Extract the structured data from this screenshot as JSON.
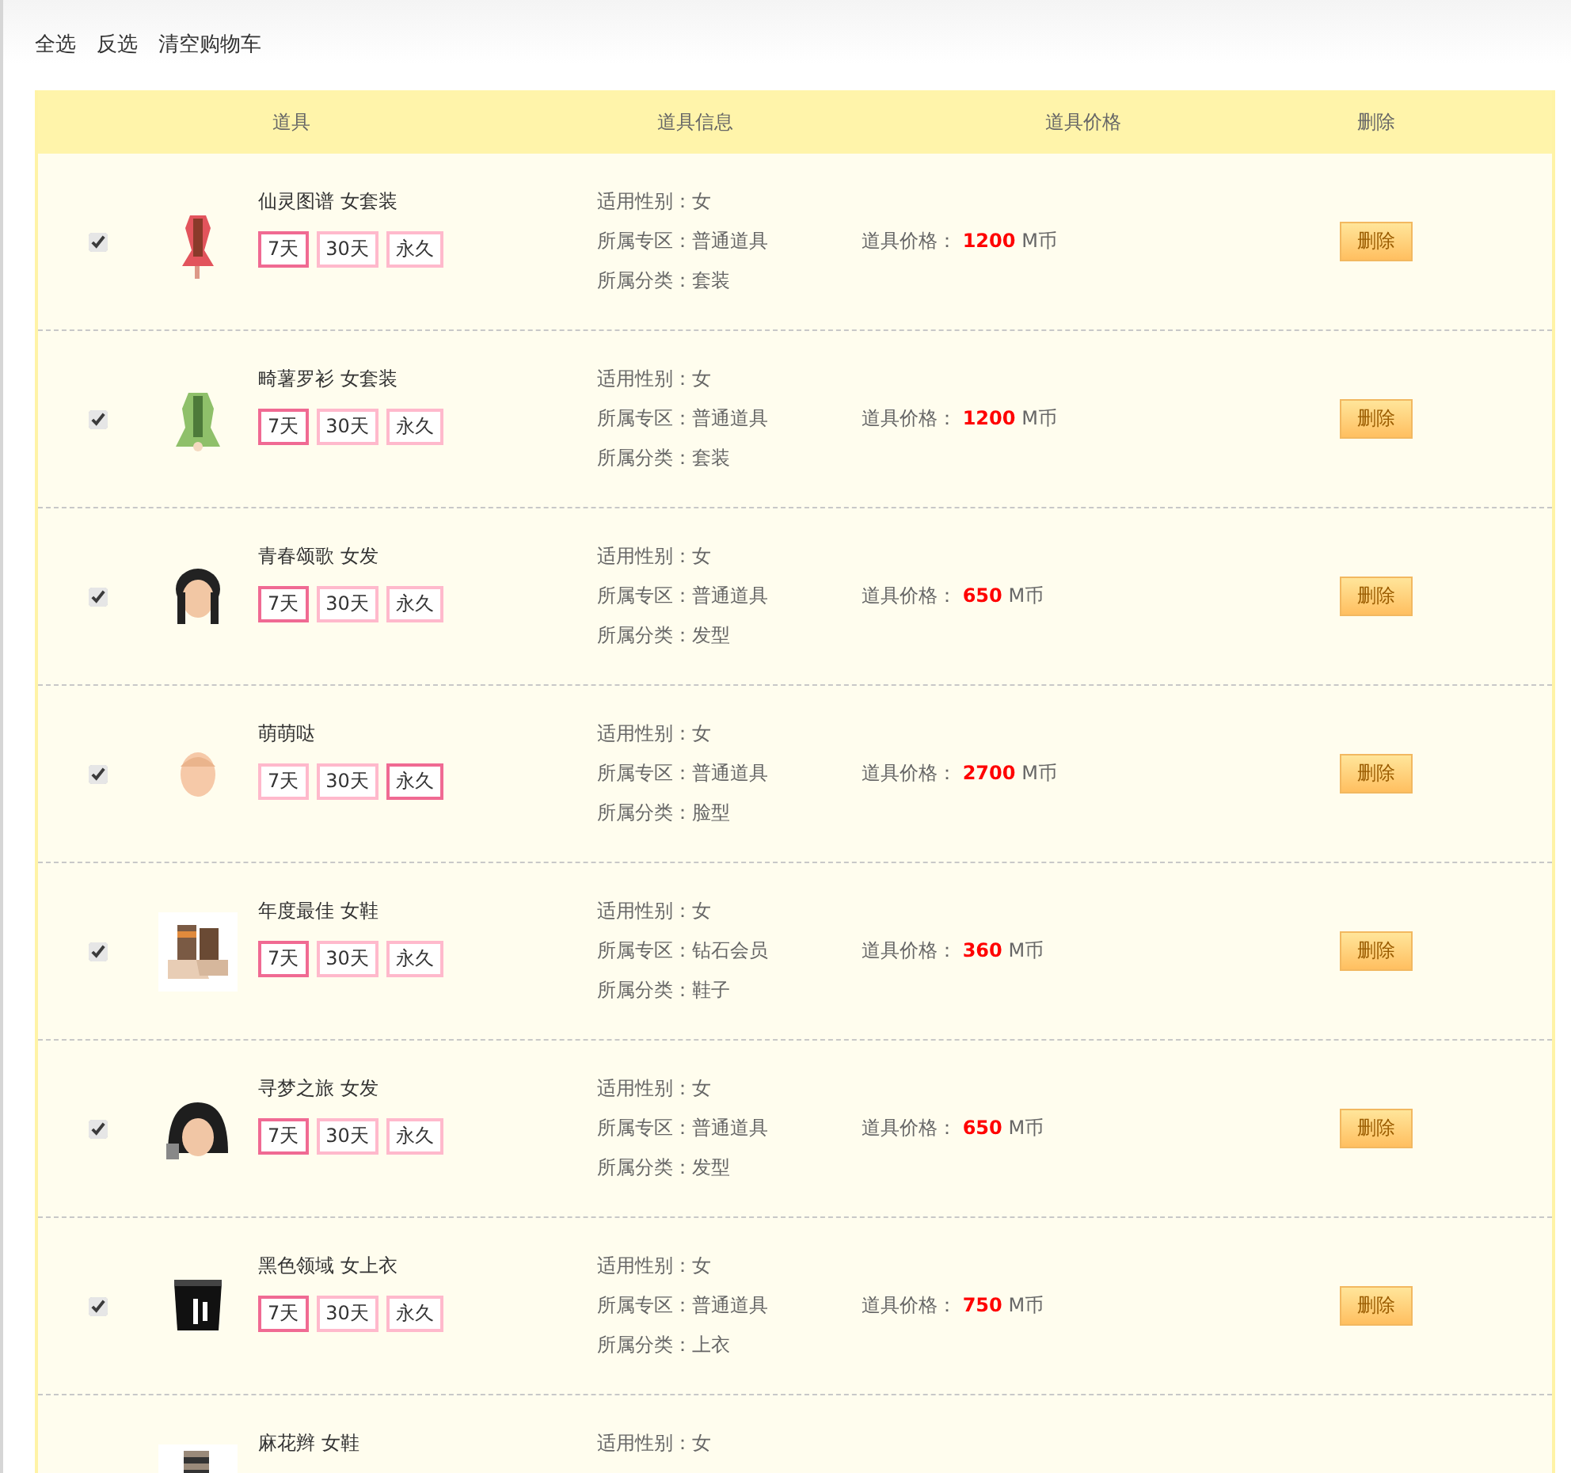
{
  "toolbar": [
    "全选",
    "反选",
    "清空购物车"
  ],
  "table": {
    "columns": [
      "道具",
      "道具信息",
      "道具价格",
      "删除"
    ],
    "rows": [
      {
        "checked": true,
        "image": {
          "kind": "picture"
        },
        "name": "仙灵图谱 女套装",
        "durations": [
          {
            "label": "7天",
            "selected": true
          },
          {
            "label": "30天",
            "selected": false
          },
          {
            "label": "永久",
            "selected": false
          }
        ],
        "info": [
          "适用性别：女",
          "所属专区：普通道具",
          "所属分类：套装"
        ],
        "price_label": "道具价格：",
        "price": "1200",
        "unit": "M币",
        "delete": "删除"
      },
      {
        "checked": true,
        "image": {
          "kind": "picture"
        },
        "name": "畸薯罗衫 女套装",
        "durations": [
          {
            "label": "7天",
            "selected": true
          },
          {
            "label": "30天",
            "selected": false
          },
          {
            "label": "永久",
            "selected": false
          }
        ],
        "info": [
          "适用性别：女",
          "所属专区：普通道具",
          "所属分类：套装"
        ],
        "price_label": "道具价格：",
        "price": "1200",
        "unit": "M币",
        "delete": "删除"
      },
      {
        "checked": true,
        "image": {
          "kind": "picture"
        },
        "name": "青春颂歌 女发",
        "durations": [
          {
            "label": "7天",
            "selected": true
          },
          {
            "label": "30天",
            "selected": false
          },
          {
            "label": "永久",
            "selected": false
          }
        ],
        "info": [
          "适用性别：女",
          "所属专区：普通道具",
          "所属分类：发型"
        ],
        "price_label": "道具价格：",
        "price": "650",
        "unit": "M币",
        "delete": "删除"
      },
      {
        "checked": true,
        "image": {
          "kind": "picture"
        },
        "name": "萌萌哒",
        "durations": [
          {
            "label": "7天",
            "selected": false
          },
          {
            "label": "30天",
            "selected": false
          },
          {
            "label": "永久",
            "selected": true
          }
        ],
        "info": [
          "适用性别：女",
          "所属专区：普通道具",
          "所属分类：脸型"
        ],
        "price_label": "道具价格：",
        "price": "2700",
        "unit": "M币",
        "delete": "删除"
      },
      {
        "checked": true,
        "image": {
          "kind": "picture"
        },
        "name": "年度最佳 女鞋",
        "durations": [
          {
            "label": "7天",
            "selected": true
          },
          {
            "label": "30天",
            "selected": false
          },
          {
            "label": "永久",
            "selected": false
          }
        ],
        "info": [
          "适用性别：女",
          "所属专区：钻石会员",
          "所属分类：鞋子"
        ],
        "price_label": "道具价格：",
        "price": "360",
        "unit": "M币",
        "delete": "删除"
      },
      {
        "checked": true,
        "image": {
          "kind": "picture"
        },
        "name": "寻梦之旅 女发",
        "durations": [
          {
            "label": "7天",
            "selected": true
          },
          {
            "label": "30天",
            "selected": false
          },
          {
            "label": "永久",
            "selected": false
          }
        ],
        "info": [
          "适用性别：女",
          "所属专区：普通道具",
          "所属分类：发型"
        ],
        "price_label": "道具价格：",
        "price": "650",
        "unit": "M币",
        "delete": "删除"
      },
      {
        "checked": true,
        "image": {
          "kind": "picture"
        },
        "name": "黑色领域 女上衣",
        "durations": [
          {
            "label": "7天",
            "selected": true
          },
          {
            "label": "30天",
            "selected": false
          },
          {
            "label": "永久",
            "selected": false
          }
        ],
        "info": [
          "适用性别：女",
          "所属专区：普通道具",
          "所属分类：上衣"
        ],
        "price_label": "道具价格：",
        "price": "750",
        "unit": "M币",
        "delete": "删除"
      },
      {
        "image": {
          "kind": "picture"
        },
        "name": "麻花辫 女鞋",
        "info": [
          "适用性别：女"
        ]
      }
    ]
  }
}
